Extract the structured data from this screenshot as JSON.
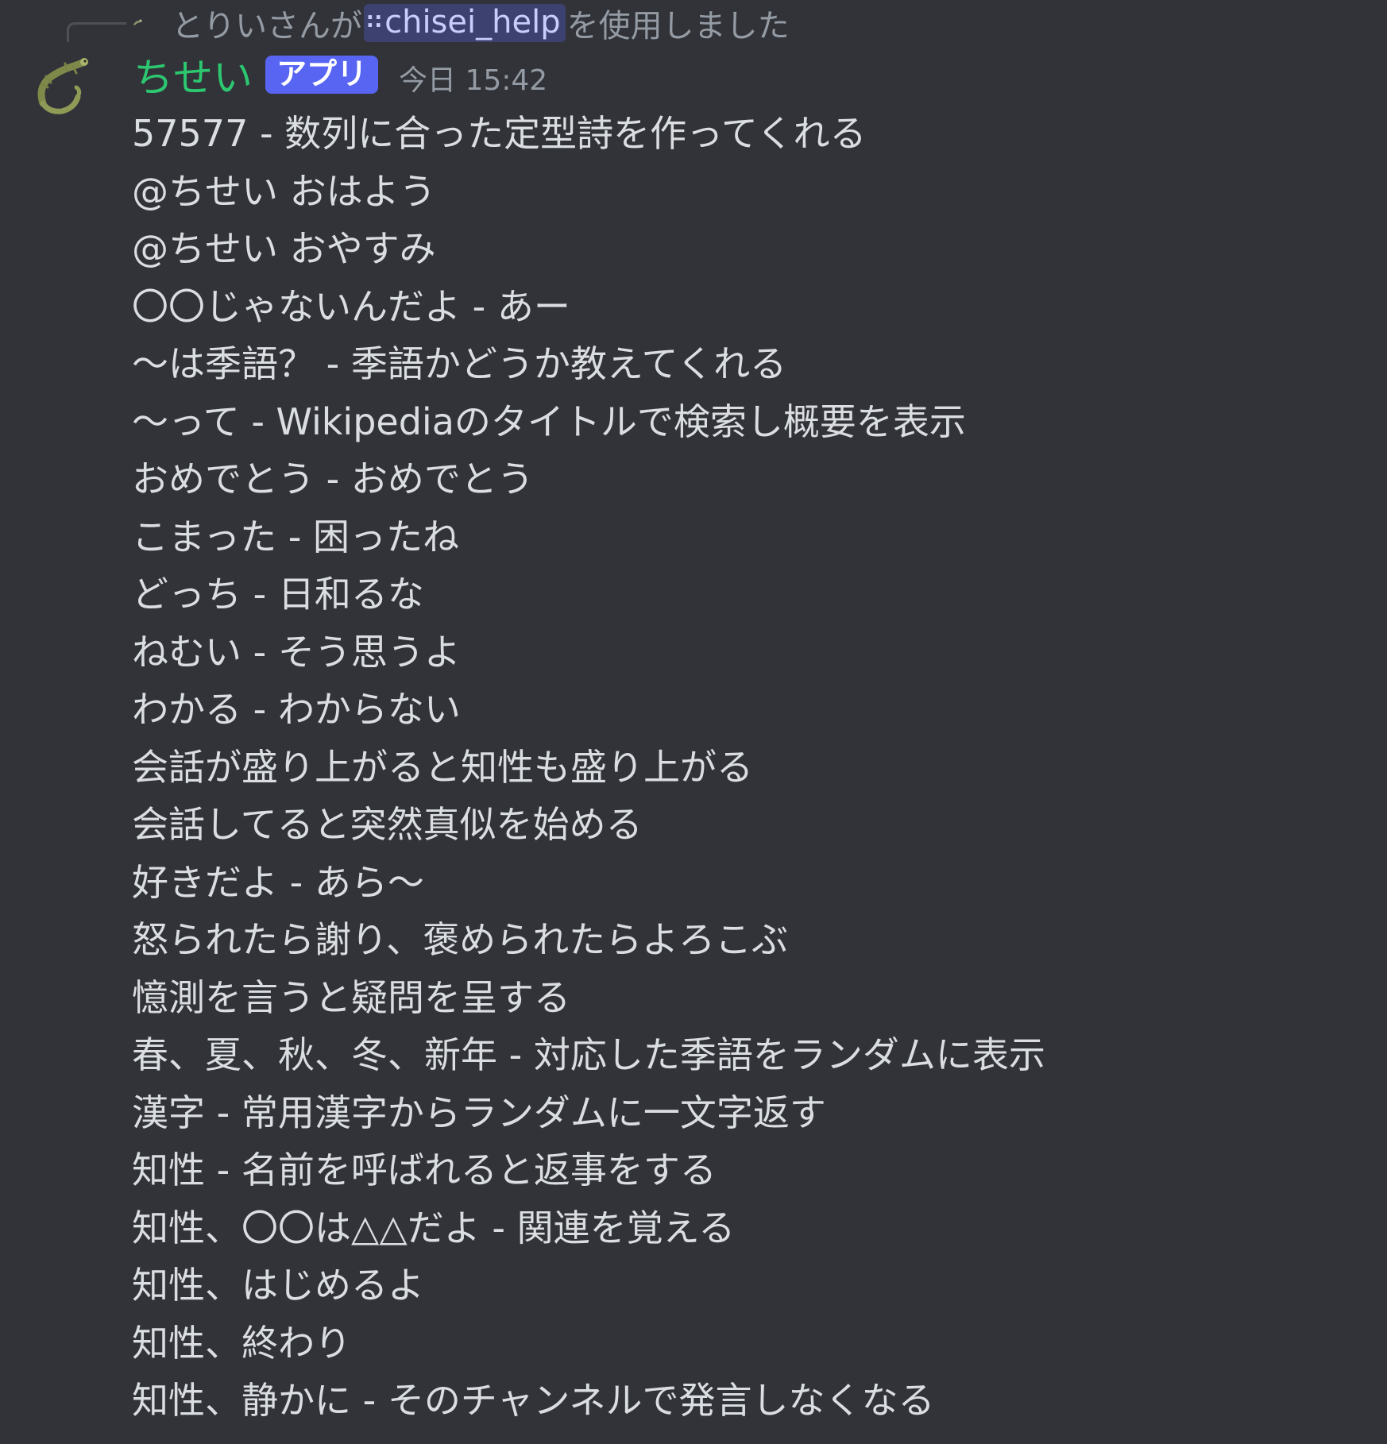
{
  "reply": {
    "text_before": "とりいさんが",
    "command": "chisei_help",
    "command_icon": "slash-command-icon",
    "text_after": "を使用しました"
  },
  "message": {
    "username": "ちせい",
    "badge": "アプリ",
    "timestamp": "今日 15:42",
    "username_color": "#2dc770",
    "badge_color": "#5865f2",
    "lines": [
      "57577 - 数列に合った定型詩を作ってくれる",
      "@ちせい おはよう",
      "@ちせい おやすみ",
      "〇〇じゃないんだよ - あー",
      "～は季語？ - 季語かどうか教えてくれる",
      "～って - Wikipediaのタイトルで検索し概要を表示",
      "おめでとう - おめでとう",
      "こまった - 困ったね",
      "どっち - 日和るな",
      "ねむい - そう思うよ",
      "わかる - わからない",
      "会話が盛り上がると知性も盛り上がる",
      "会話してると突然真似を始める",
      "好きだよ - あら～",
      "怒られたら謝り、褒められたらよろこぶ",
      "憶測を言うと疑問を呈する",
      "春、夏、秋、冬、新年 - 対応した季語をランダムに表示",
      "漢字 - 常用漢字からランダムに一文字返す",
      "知性 - 名前を呼ばれると返事をする",
      "知性、〇〇は△△だよ - 関連を覚える",
      "知性、はじめるよ",
      "知性、終わり",
      "知性、静かに - そのチャンネルで発言しなくなる"
    ]
  }
}
